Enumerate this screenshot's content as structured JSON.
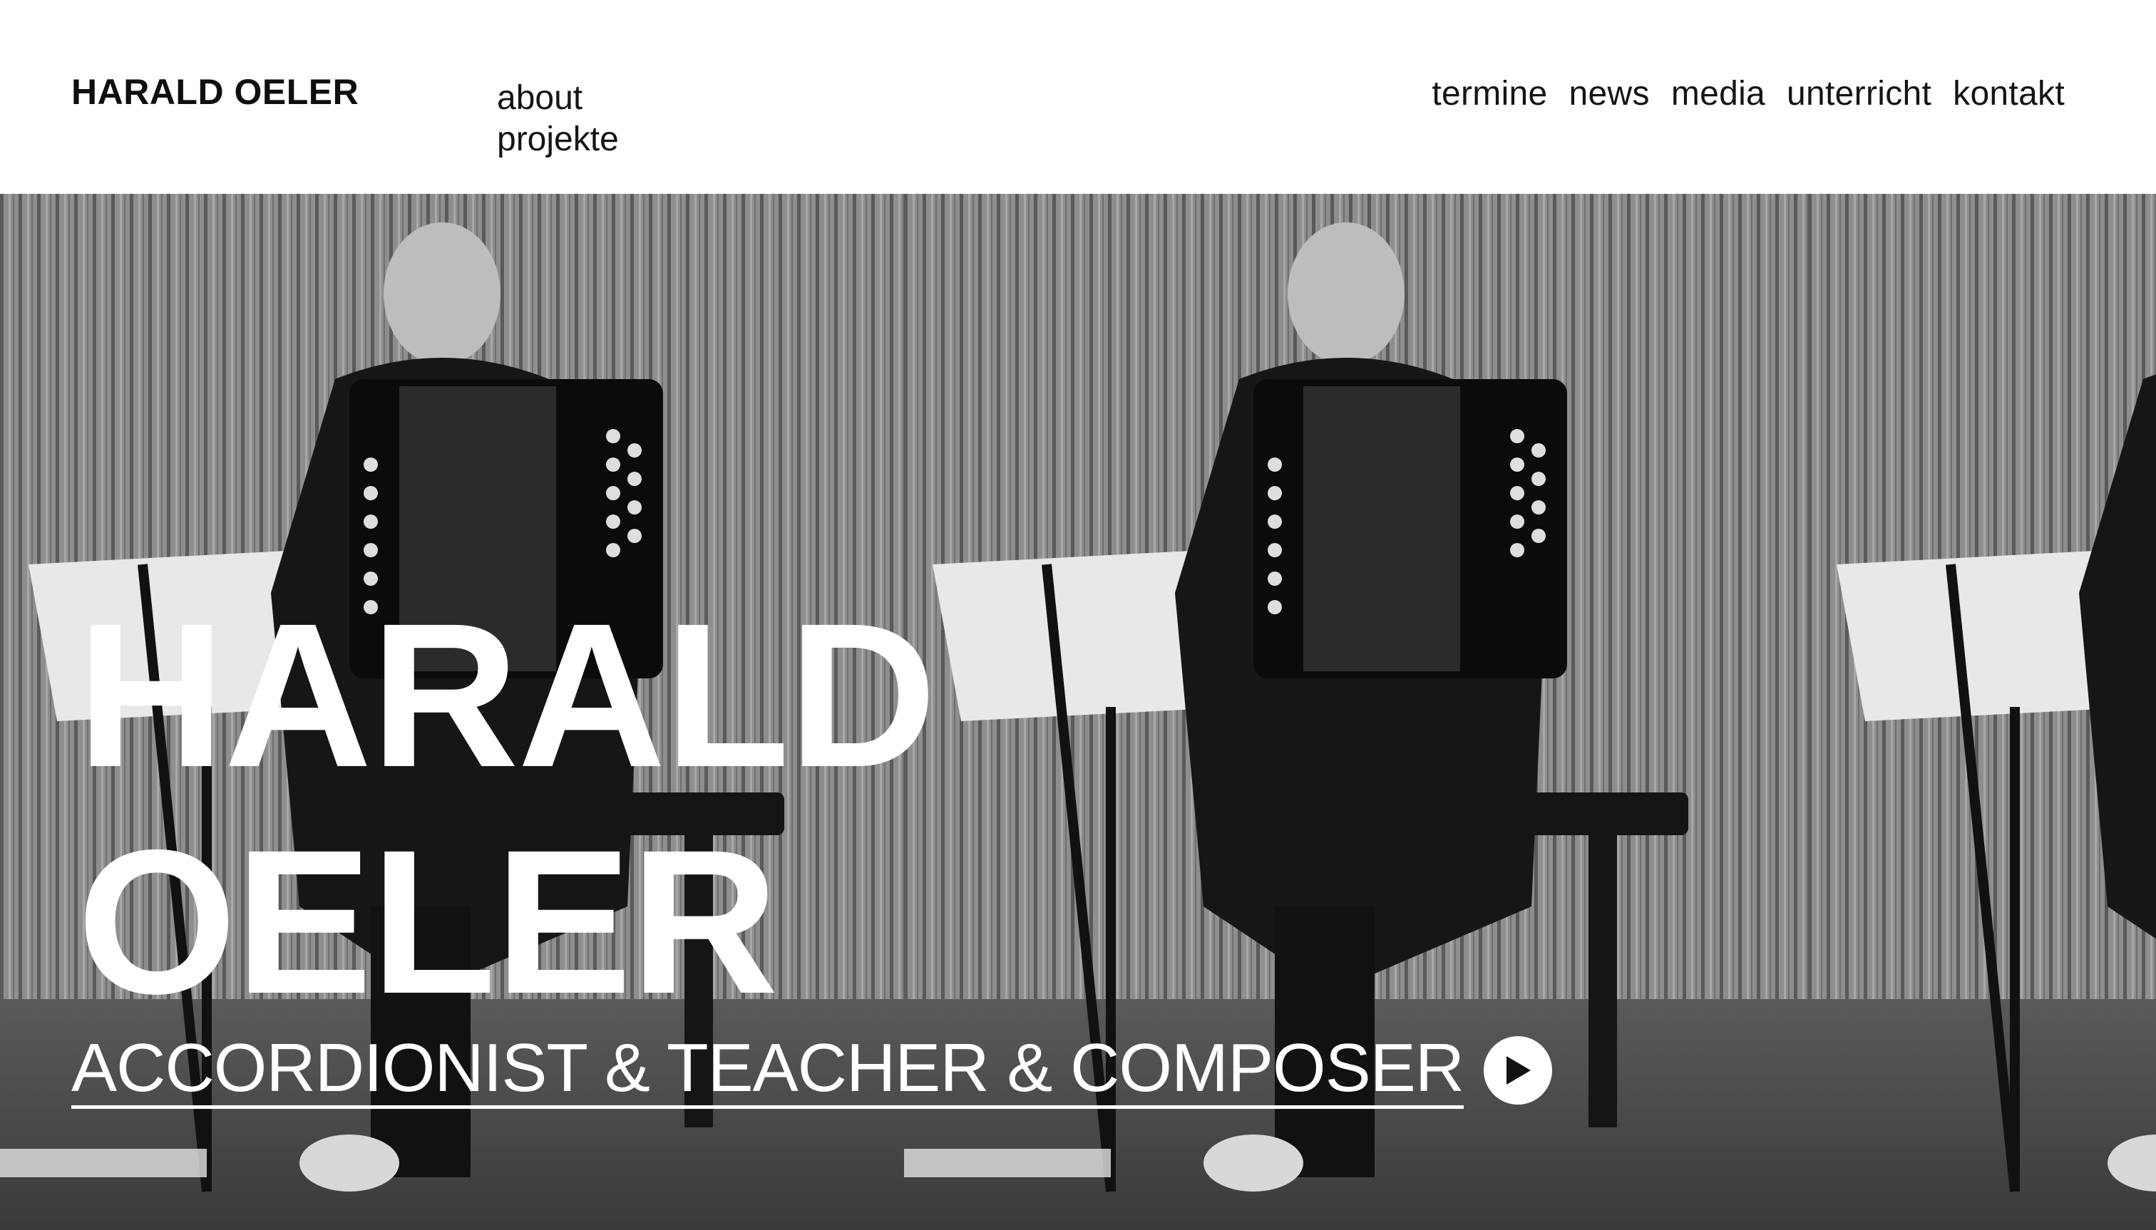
{
  "header": {
    "brand": "HARALD OELER",
    "left_nav": [
      "about",
      "projekte"
    ],
    "right_nav": [
      "termine",
      "news",
      "media",
      "unterricht",
      "kontakt"
    ]
  },
  "hero": {
    "title_line1": "HARALD",
    "title_line2": "OELER",
    "tagline": "ACCORDIONIST & TEACHER & COMPOSER",
    "cta_icon": "play-circle-icon",
    "image_description_icon": "photo-accordionist"
  },
  "colors": {
    "background": "#ffffff",
    "text_dark": "#111111",
    "hero_text": "#ffffff"
  }
}
